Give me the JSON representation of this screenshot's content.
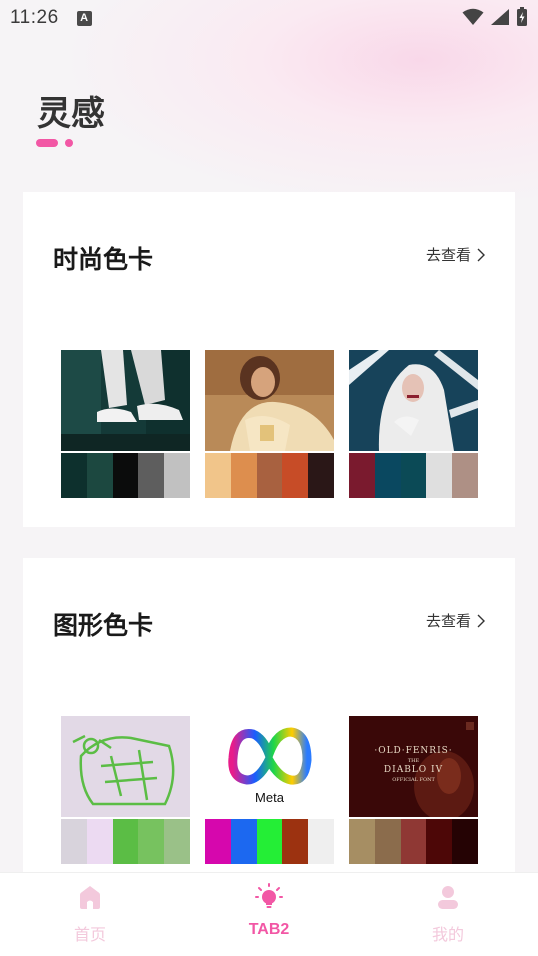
{
  "status": {
    "time": "11:26",
    "badge": "A"
  },
  "page": {
    "title": "灵感"
  },
  "sections": [
    {
      "title": "时尚色卡",
      "more": "去查看",
      "items": [
        {
          "image": "sneakers-photo",
          "colors": [
            "#0d302d",
            "#1c4840",
            "#0b0c0c",
            "#5e5e5e",
            "#c1c1c1"
          ]
        },
        {
          "image": "woman-gold-photo",
          "colors": [
            "#f1c58a",
            "#dd8e4e",
            "#a86140",
            "#c74c27",
            "#2a1717"
          ]
        },
        {
          "image": "white-hood-photo",
          "colors": [
            "#7a1a2e",
            "#0a4860",
            "#0b4a56",
            "#dfdfdf",
            "#ae9085"
          ]
        }
      ]
    },
    {
      "title": "图形色卡",
      "more": "去查看",
      "items": [
        {
          "image": "green-line-art",
          "colors": [
            "#d8d3dc",
            "#ecdaf2",
            "#5bbd45",
            "#77c25f",
            "#9ac188"
          ]
        },
        {
          "image": "meta-logo",
          "caption": "Meta",
          "colors": [
            "#d607ad",
            "#1c68f0",
            "#24ee36",
            "#9c3210",
            "#efefef"
          ]
        },
        {
          "image": "diablo-poster",
          "poster": {
            "line1": "·OLD·FENRIS·",
            "line2": "THE",
            "line3": "DIABLO IV",
            "line4": "OFFICIAL FONT"
          },
          "colors": [
            "#a68e63",
            "#8b6c4c",
            "#8f3834",
            "#4d0707",
            "#250304"
          ]
        }
      ]
    }
  ],
  "tabs": [
    {
      "label": "首页",
      "icon": "home-icon",
      "active": false
    },
    {
      "label": "TAB2",
      "icon": "lightbulb-icon",
      "active": true
    },
    {
      "label": "我的",
      "icon": "person-icon",
      "active": false
    }
  ],
  "colors": {
    "accent": "#f257a5",
    "inactive_tab": "#f3c9dc"
  }
}
